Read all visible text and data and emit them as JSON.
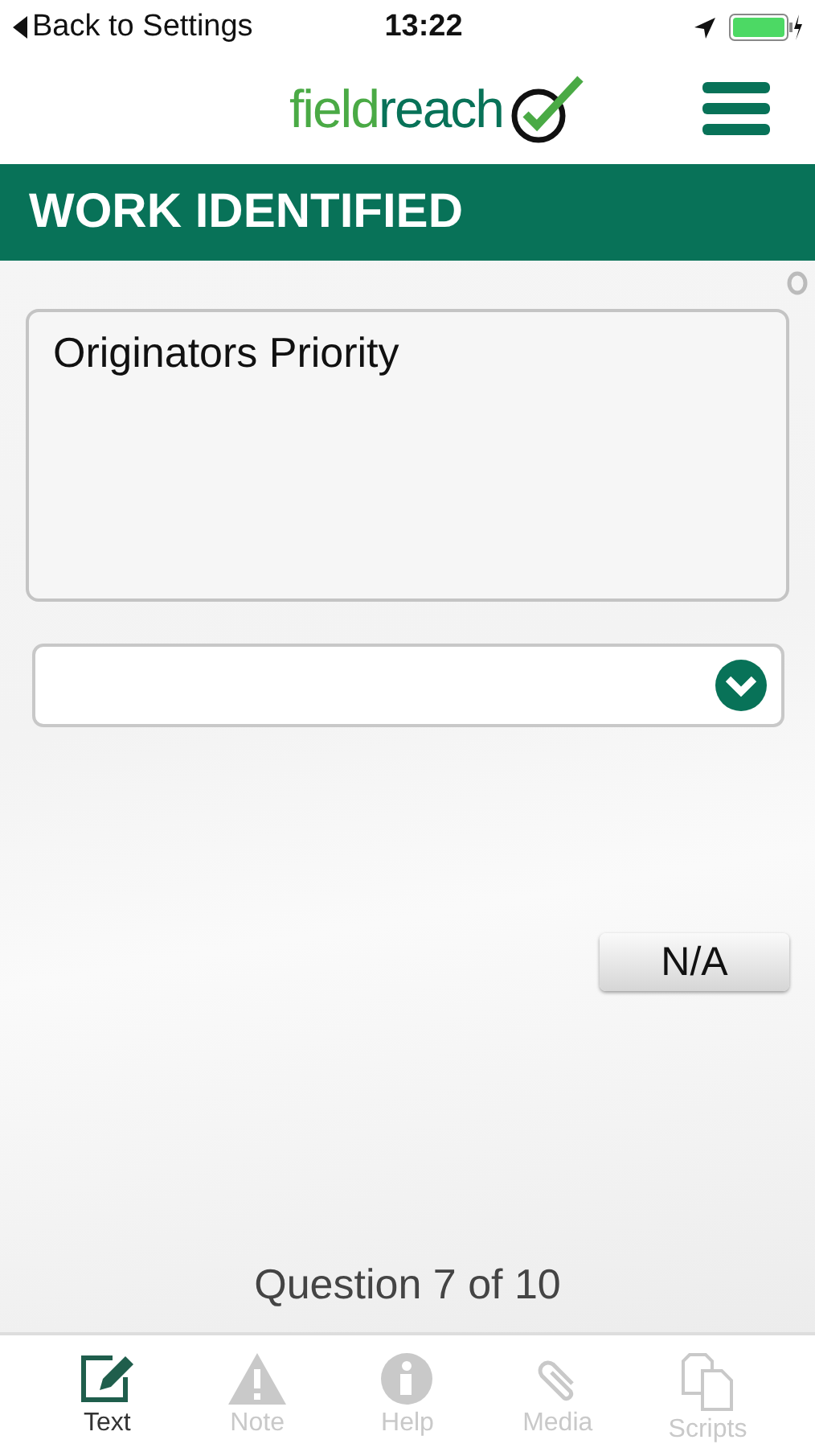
{
  "status_bar": {
    "back": "Back to Settings",
    "time": "13:22"
  },
  "header": {
    "logo": {
      "first": "field",
      "second": "reach"
    }
  },
  "section": {
    "title": "WORK IDENTIFIED"
  },
  "question": {
    "text": "Originators Priority",
    "dropdown": {
      "expanded": false
    },
    "na_button": "N/A",
    "counter": "Question 7 of 10"
  },
  "tabs": [
    {
      "label": "Text",
      "kind": "edit",
      "selected": true
    },
    {
      "label": "Note",
      "kind": "warning",
      "selected": false
    },
    {
      "label": "Help",
      "kind": "info",
      "selected": false
    },
    {
      "label": "Media",
      "kind": "clip",
      "selected": false
    },
    {
      "label": "Scripts",
      "kind": "copy",
      "selected": false
    }
  ]
}
